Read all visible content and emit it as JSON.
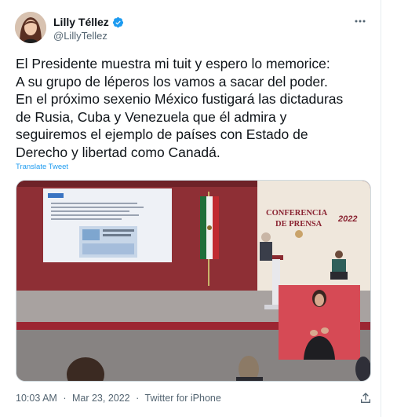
{
  "tweet": {
    "display_name": "Lilly Téllez",
    "handle": "@LillyTellez",
    "verified": true,
    "text_lines": [
      "El Presidente muestra mi tuit y espero lo memorice:",
      "A su grupo de léperos los vamos a sacar del poder.",
      "En el próximo sexenio México fustigará las dictaduras",
      "de Rusia, Cuba y Venezuela que él admira y",
      "seguiremos el ejemplo de países con Estado de",
      "Derecho y libertad como Canadá."
    ],
    "translate_label": "Translate Tweet",
    "time": "10:03 AM",
    "separator": "·",
    "date": "Mar 23, 2022",
    "source": "Twitter for iPhone"
  },
  "media": {
    "banner_line1": "CONFERENCIA",
    "banner_line2": "DE PRENSA",
    "banner_year": "2022"
  },
  "icons": {
    "more": "more-horizontal-icon",
    "verified": "verified-badge-icon",
    "share": "share-icon"
  },
  "colors": {
    "link": "#1d9bf0",
    "verified": "#1d9bf0",
    "stage_red": "#9b2430",
    "banner_text": "#8a2432"
  }
}
